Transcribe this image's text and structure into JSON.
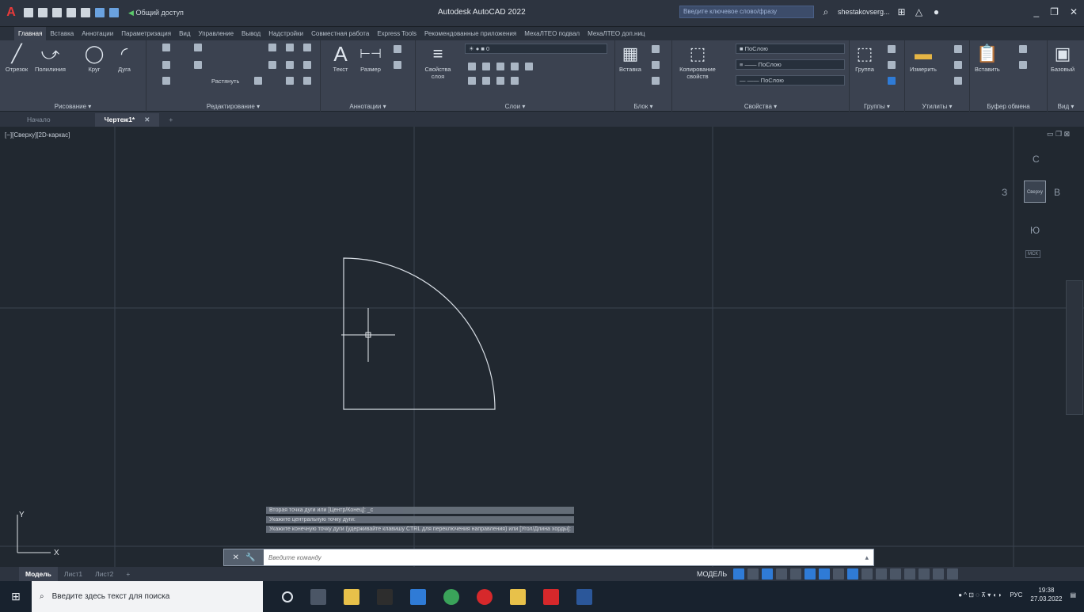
{
  "titlebar": {
    "share_label": "Общий доступ",
    "app_title": "Autodesk AutoCAD 2022",
    "search_placeholder": "Введите ключевое слово/фразу",
    "user": "shestakovserg..."
  },
  "ribbon_tabs": [
    "Главная",
    "Вставка",
    "Аннотации",
    "Параметризация",
    "Вид",
    "Управление",
    "Вывод",
    "Надстройки",
    "Совместная работа",
    "Express Tools",
    "Рекомендованные приложения",
    "МехаЛТЕО подвал",
    "МехаЛТЕО доп.ниц"
  ],
  "ribbon": {
    "draw": {
      "title": "Рисование ▾",
      "tools": [
        "Отрезок",
        "Полилиния",
        "Круг",
        "Дуга"
      ]
    },
    "modify": {
      "title": "Редактирование ▾",
      "stretch": "Растянуть"
    },
    "annotation": {
      "title": "Аннотации ▾",
      "text": "Текст",
      "dimension": "Размер"
    },
    "layers": {
      "title": "Слои ▾",
      "layer_props": "Свойства слоя",
      "current_layer": "0"
    },
    "block": {
      "title": "Блок ▾",
      "insert": "Вставка"
    },
    "properties": {
      "title": "Свойства ▾",
      "match": "Копирование свойств",
      "bylayer1": "ПоСлою",
      "bylayer2": "ПоСлою",
      "bylayer3": "ПоСлою"
    },
    "groups": {
      "title": "Группы ▾",
      "group": "Группа"
    },
    "utilities": {
      "title": "Утилиты ▾",
      "measure": "Измерить"
    },
    "clipboard": {
      "title": "Буфер обмена",
      "paste": "Вставить"
    },
    "view": {
      "title": "Вид ▾",
      "base": "Базовый"
    }
  },
  "doc_tabs": {
    "start": "Начало",
    "drawing": "Чертеж1*"
  },
  "viewport": {
    "label": "[−][Сверху][2D-каркас]",
    "viewcube": {
      "n": "С",
      "w": "З",
      "e": "В",
      "s": "Ю",
      "top": "Сверху",
      "ucs": "МСК"
    }
  },
  "command": {
    "history": [
      "Вторая точка дуги или [Центр/Конец]: _c",
      "Укажите центральную точку дуги:",
      "Укажите конечную точку дуги (удерживайте клавишу CTRL для переключения направления) или [Угол/Длина хорды]:"
    ],
    "placeholder": "Введите команду"
  },
  "layout_tabs": [
    "Модель",
    "Лист1",
    "Лист2"
  ],
  "status": {
    "model": "МОДЕЛЬ"
  },
  "taskbar": {
    "search_placeholder": "Введите здесь текст для поиска",
    "lang": "РУС",
    "time": "19:38",
    "date": "27.03.2022"
  },
  "colors": {
    "accent": "#2f7bd6",
    "canvas": "#212830",
    "ribbon": "#3b4250"
  }
}
